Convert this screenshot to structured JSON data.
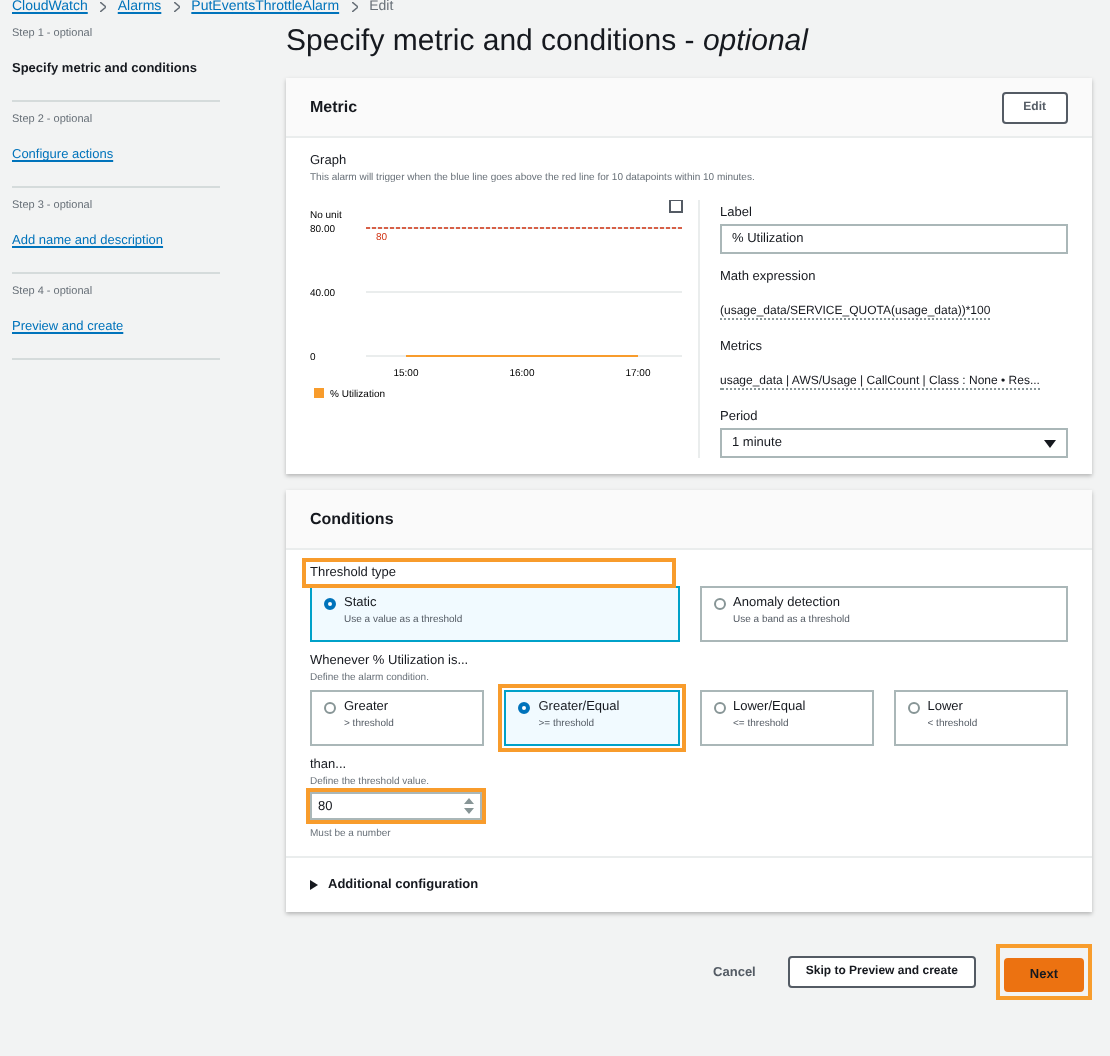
{
  "breadcrumbs": [
    "CloudWatch",
    "Alarms",
    "PutEventsThrottleAlarm",
    "Edit"
  ],
  "steps": [
    {
      "step": "Step 1 - optional",
      "title": "Specify metric and conditions",
      "selected": true
    },
    {
      "step": "Step 2 - optional",
      "title": "Configure actions",
      "selected": false
    },
    {
      "step": "Step 3 - optional",
      "title": "Add name and description",
      "selected": false
    },
    {
      "step": "Step 4 - optional",
      "title": "Preview and create",
      "selected": false
    }
  ],
  "page_title": "Specify metric and conditions - *optional*",
  "metric": {
    "title": "Metric",
    "edit_button": "Edit",
    "graph_label": "Graph",
    "graph_description": "This alarm will trigger when the blue line goes above the red line for 10 datapoints within 10 minutes.",
    "chart_data": {
      "type": "line",
      "ylabel": "No unit",
      "categories": [
        "15:00",
        "16:00",
        "17:00"
      ],
      "series": [
        {
          "name": "% Utilization",
          "color": "#f89c2c",
          "values": [
            0,
            0,
            0
          ]
        }
      ],
      "ylim": [
        0,
        80
      ],
      "yticks": [
        {
          "value": 0,
          "label": "0"
        },
        {
          "value": 40,
          "label": "40.00"
        },
        {
          "value": 80,
          "label": "80.00"
        }
      ]
    },
    "threshold_label": "80",
    "label_field": {
      "label": "Label",
      "value": "% Utilization"
    },
    "math_expression": {
      "label": "Math expression",
      "value": "(usage_data/SERVICE_QUOTA(usage_data))*100"
    },
    "metrics": {
      "label": "Metrics",
      "value": "usage_data | AWS/Usage | CallCount | Class : None • Res..."
    },
    "period": {
      "label": "Period",
      "value": "1 minute"
    }
  },
  "conditions": {
    "title": "Conditions",
    "threshold_type": {
      "label": "Threshold type",
      "highlighted": true,
      "options": [
        {
          "title": "Static",
          "description": "Use a value as a threshold",
          "selected": true
        },
        {
          "title": "Anomaly detection",
          "description": "Use a band as a threshold",
          "selected": false
        }
      ]
    },
    "whenever": {
      "label": "Whenever % Utilization is...",
      "description": "Define the alarm condition.",
      "options": [
        {
          "title": "Greater",
          "description": "> threshold",
          "selected": false,
          "highlighted": false
        },
        {
          "title": "Greater/Equal",
          "description": ">= threshold",
          "selected": true,
          "highlighted": true
        },
        {
          "title": "Lower/Equal",
          "description": "<= threshold",
          "selected": false,
          "highlighted": false
        },
        {
          "title": "Lower",
          "description": "< threshold",
          "selected": false,
          "highlighted": false
        }
      ]
    },
    "than": {
      "label": "than...",
      "description": "Define the threshold value.",
      "value": "80",
      "highlighted": true,
      "hint": "Must be a number"
    },
    "additional": {
      "label": "Additional configuration",
      "expanded": false
    }
  },
  "footer": {
    "cancel": "Cancel",
    "skip": "Skip to Preview and create",
    "next": "Next",
    "next_highlighted": true
  }
}
